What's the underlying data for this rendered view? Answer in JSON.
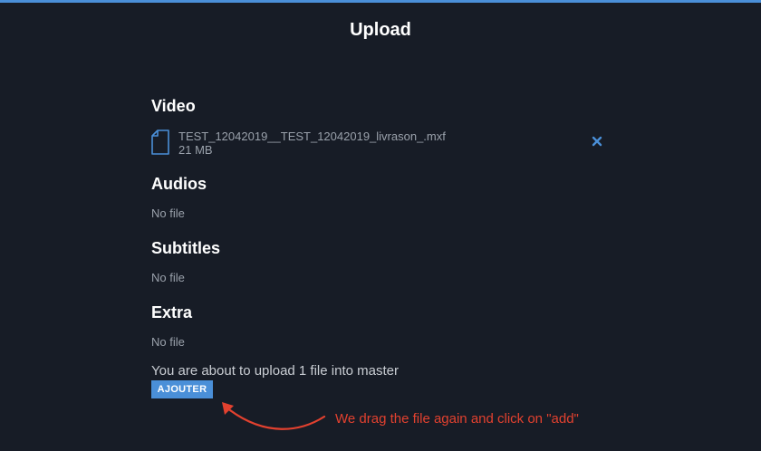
{
  "dialog": {
    "title": "Upload"
  },
  "sections": {
    "video": {
      "title": "Video",
      "files": [
        {
          "name": "TEST_12042019__TEST_12042019_livrason_.mxf",
          "size": "21 MB",
          "icon": "file-icon",
          "remove_icon": "close-icon"
        }
      ]
    },
    "audios": {
      "title": "Audios",
      "empty_text": "No file"
    },
    "subtitles": {
      "title": "Subtitles",
      "empty_text": "No file"
    },
    "extra": {
      "title": "Extra",
      "empty_text": "No file"
    }
  },
  "summary": {
    "text": "You are about to upload 1 file into master"
  },
  "actions": {
    "add_label": "AJOUTER"
  },
  "annotation": {
    "text": "We drag the file again and click on \"add\"",
    "color": "#e2412f"
  },
  "colors": {
    "background": "#171c26",
    "accent": "#4a8fd8",
    "muted_text": "#9aa1ab"
  }
}
